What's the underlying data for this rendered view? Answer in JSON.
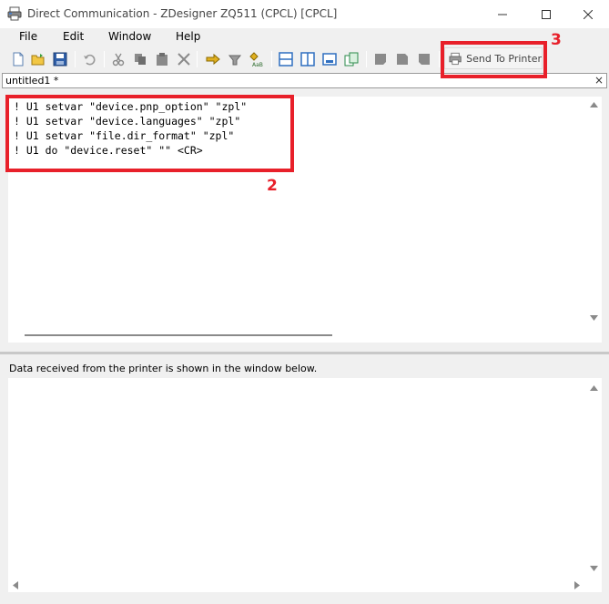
{
  "window": {
    "title": "Direct Communication - ZDesigner ZQ511 (CPCL) [CPCL]"
  },
  "menu": {
    "items": [
      "File",
      "Edit",
      "Window",
      "Help"
    ]
  },
  "toolbar": {
    "send_label": "Send To Printer",
    "icons": [
      "new-file-icon",
      "open-folder-icon",
      "save-icon",
      "undo-icon",
      "cut-icon",
      "copy-icon",
      "paste-icon",
      "delete-icon",
      "send-file-icon",
      "receive-icon",
      "font-icon",
      "split-horizontal-icon",
      "split-vertical-icon",
      "single-view-icon",
      "tile-icon",
      "label-icon-1",
      "label-icon-2",
      "label-icon-3"
    ]
  },
  "tab": {
    "label": "untitled1 *",
    "close": "×"
  },
  "editor": {
    "lines": [
      "! U1 setvar \"device.pnp_option\" \"zpl\"",
      "! U1 setvar \"device.languages\" \"zpl\"",
      "! U1 setvar \"file.dir_format\" \"zpl\"",
      "! U1 do \"device.reset\" \"\" <CR>"
    ]
  },
  "output": {
    "label": "Data received from the printer is shown in the window below."
  },
  "annotations": {
    "commands_number": "2",
    "send_number": "3",
    "color": "#e8202a"
  }
}
